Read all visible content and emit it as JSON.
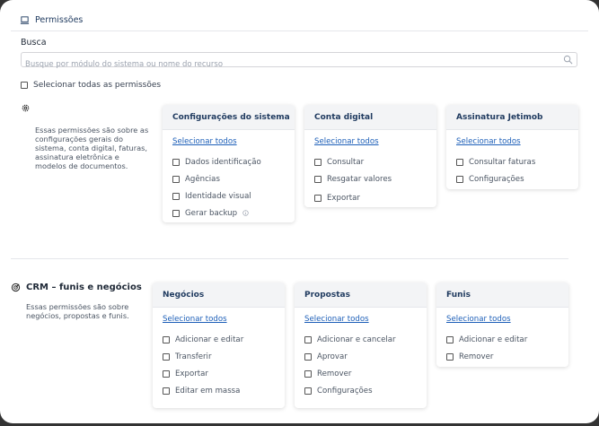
{
  "header": {
    "title": "Permissões"
  },
  "search": {
    "label": "Busca",
    "placeholder": "Busque por módulo do sistema ou nome do recurso"
  },
  "select_all_label": "Selecionar todas as permissões",
  "sections": [
    {
      "icon": "gear-icon",
      "title": "",
      "description": "Essas permissões são sobre as configurações gerais do sistema, conta digital, faturas, assinatura eletrônica e modelos de documentos.",
      "cards": [
        {
          "title": "Configurações do sistema",
          "select_all": "Selecionar todos",
          "options": [
            "Dados identificação",
            "Agências",
            "Identidade visual",
            "Gerar backup"
          ]
        },
        {
          "title": "Conta digital",
          "select_all": "Selecionar todos",
          "options": [
            "Consultar",
            "Resgatar valores",
            "Exportar"
          ]
        },
        {
          "title": "Assinatura Jetimob",
          "select_all": "Selecionar todos",
          "options": [
            "Consultar faturas",
            "Configurações"
          ]
        }
      ]
    },
    {
      "icon": "target-icon",
      "title": "CRM – funis e negócios",
      "description": "Essas permissões são sobre negócios, propostas e funis.",
      "cards": [
        {
          "title": "Negócios",
          "select_all": "Selecionar todos",
          "options": [
            "Adicionar e editar",
            "Transferir",
            "Exportar",
            "Editar em massa"
          ]
        },
        {
          "title": "Propostas",
          "select_all": "Selecionar todos",
          "options": [
            "Adicionar e cancelar",
            "Aprovar",
            "Remover",
            "Configurações"
          ]
        },
        {
          "title": "Funis",
          "select_all": "Selecionar todos",
          "options": [
            "Adicionar e editar",
            "Remover"
          ]
        }
      ]
    }
  ]
}
